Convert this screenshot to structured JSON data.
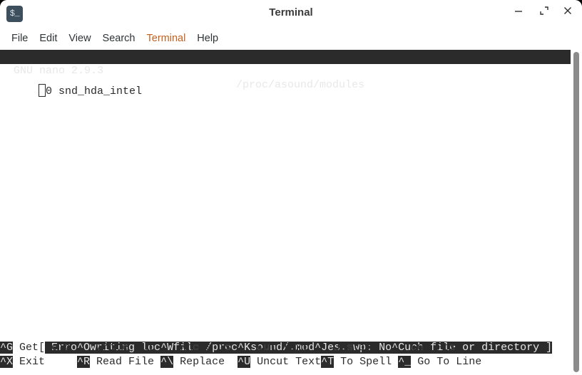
{
  "window": {
    "title": "Terminal",
    "icon": "terminal-prompt-icon",
    "icon_glyph": "$_",
    "controls": {
      "minimize": "minimize-icon",
      "maximize": "maximize-icon",
      "close": "close-icon"
    }
  },
  "menubar": {
    "items": [
      {
        "label": "File",
        "accent": false
      },
      {
        "label": "Edit",
        "accent": false
      },
      {
        "label": "View",
        "accent": false
      },
      {
        "label": "Search",
        "accent": false
      },
      {
        "label": "Terminal",
        "accent": true
      },
      {
        "label": "Help",
        "accent": false
      }
    ]
  },
  "nano": {
    "version": "GNU nano 2.9.3",
    "filename": "/proc/asound/modules",
    "buffer": {
      "cursor_column": 0,
      "lines": [
        {
          "text": "0 snd_hda_intel"
        }
      ]
    },
    "status": {
      "open_bracket": "[",
      "message": " Error writing lock file /proc/asound/.modules.swp: No such file or directory ]"
    },
    "shortcuts_row1": [
      {
        "key": "^G",
        "label": " Get Help "
      },
      {
        "key": "^O",
        "label": " Write Out "
      },
      {
        "key": "^W",
        "label": " Where Is "
      },
      {
        "key": "^K",
        "label": " Cut Text "
      },
      {
        "key": "^J",
        "label": " Justify  "
      },
      {
        "key": "^C",
        "label": " Cur Pos"
      }
    ],
    "shortcuts_row2": [
      {
        "key": "^X",
        "label": " Exit     "
      },
      {
        "key": "^R",
        "label": " Read File "
      },
      {
        "key": "^\\",
        "label": " Replace  "
      },
      {
        "key": "^U",
        "label": " Uncut Text"
      },
      {
        "key": "^T",
        "label": " To Spell "
      },
      {
        "key": "^_",
        "label": " Go To Line"
      }
    ]
  },
  "colors": {
    "terminal_background": "#ffffff",
    "terminal_foreground": "#2b2b2b",
    "inverted_background": "#2b2b2b",
    "inverted_foreground": "#e8e8e8",
    "titlebar_background": "#ffffff",
    "menu_accent": "#c4601d",
    "scrollbar_thumb": "#8b8b8b"
  }
}
